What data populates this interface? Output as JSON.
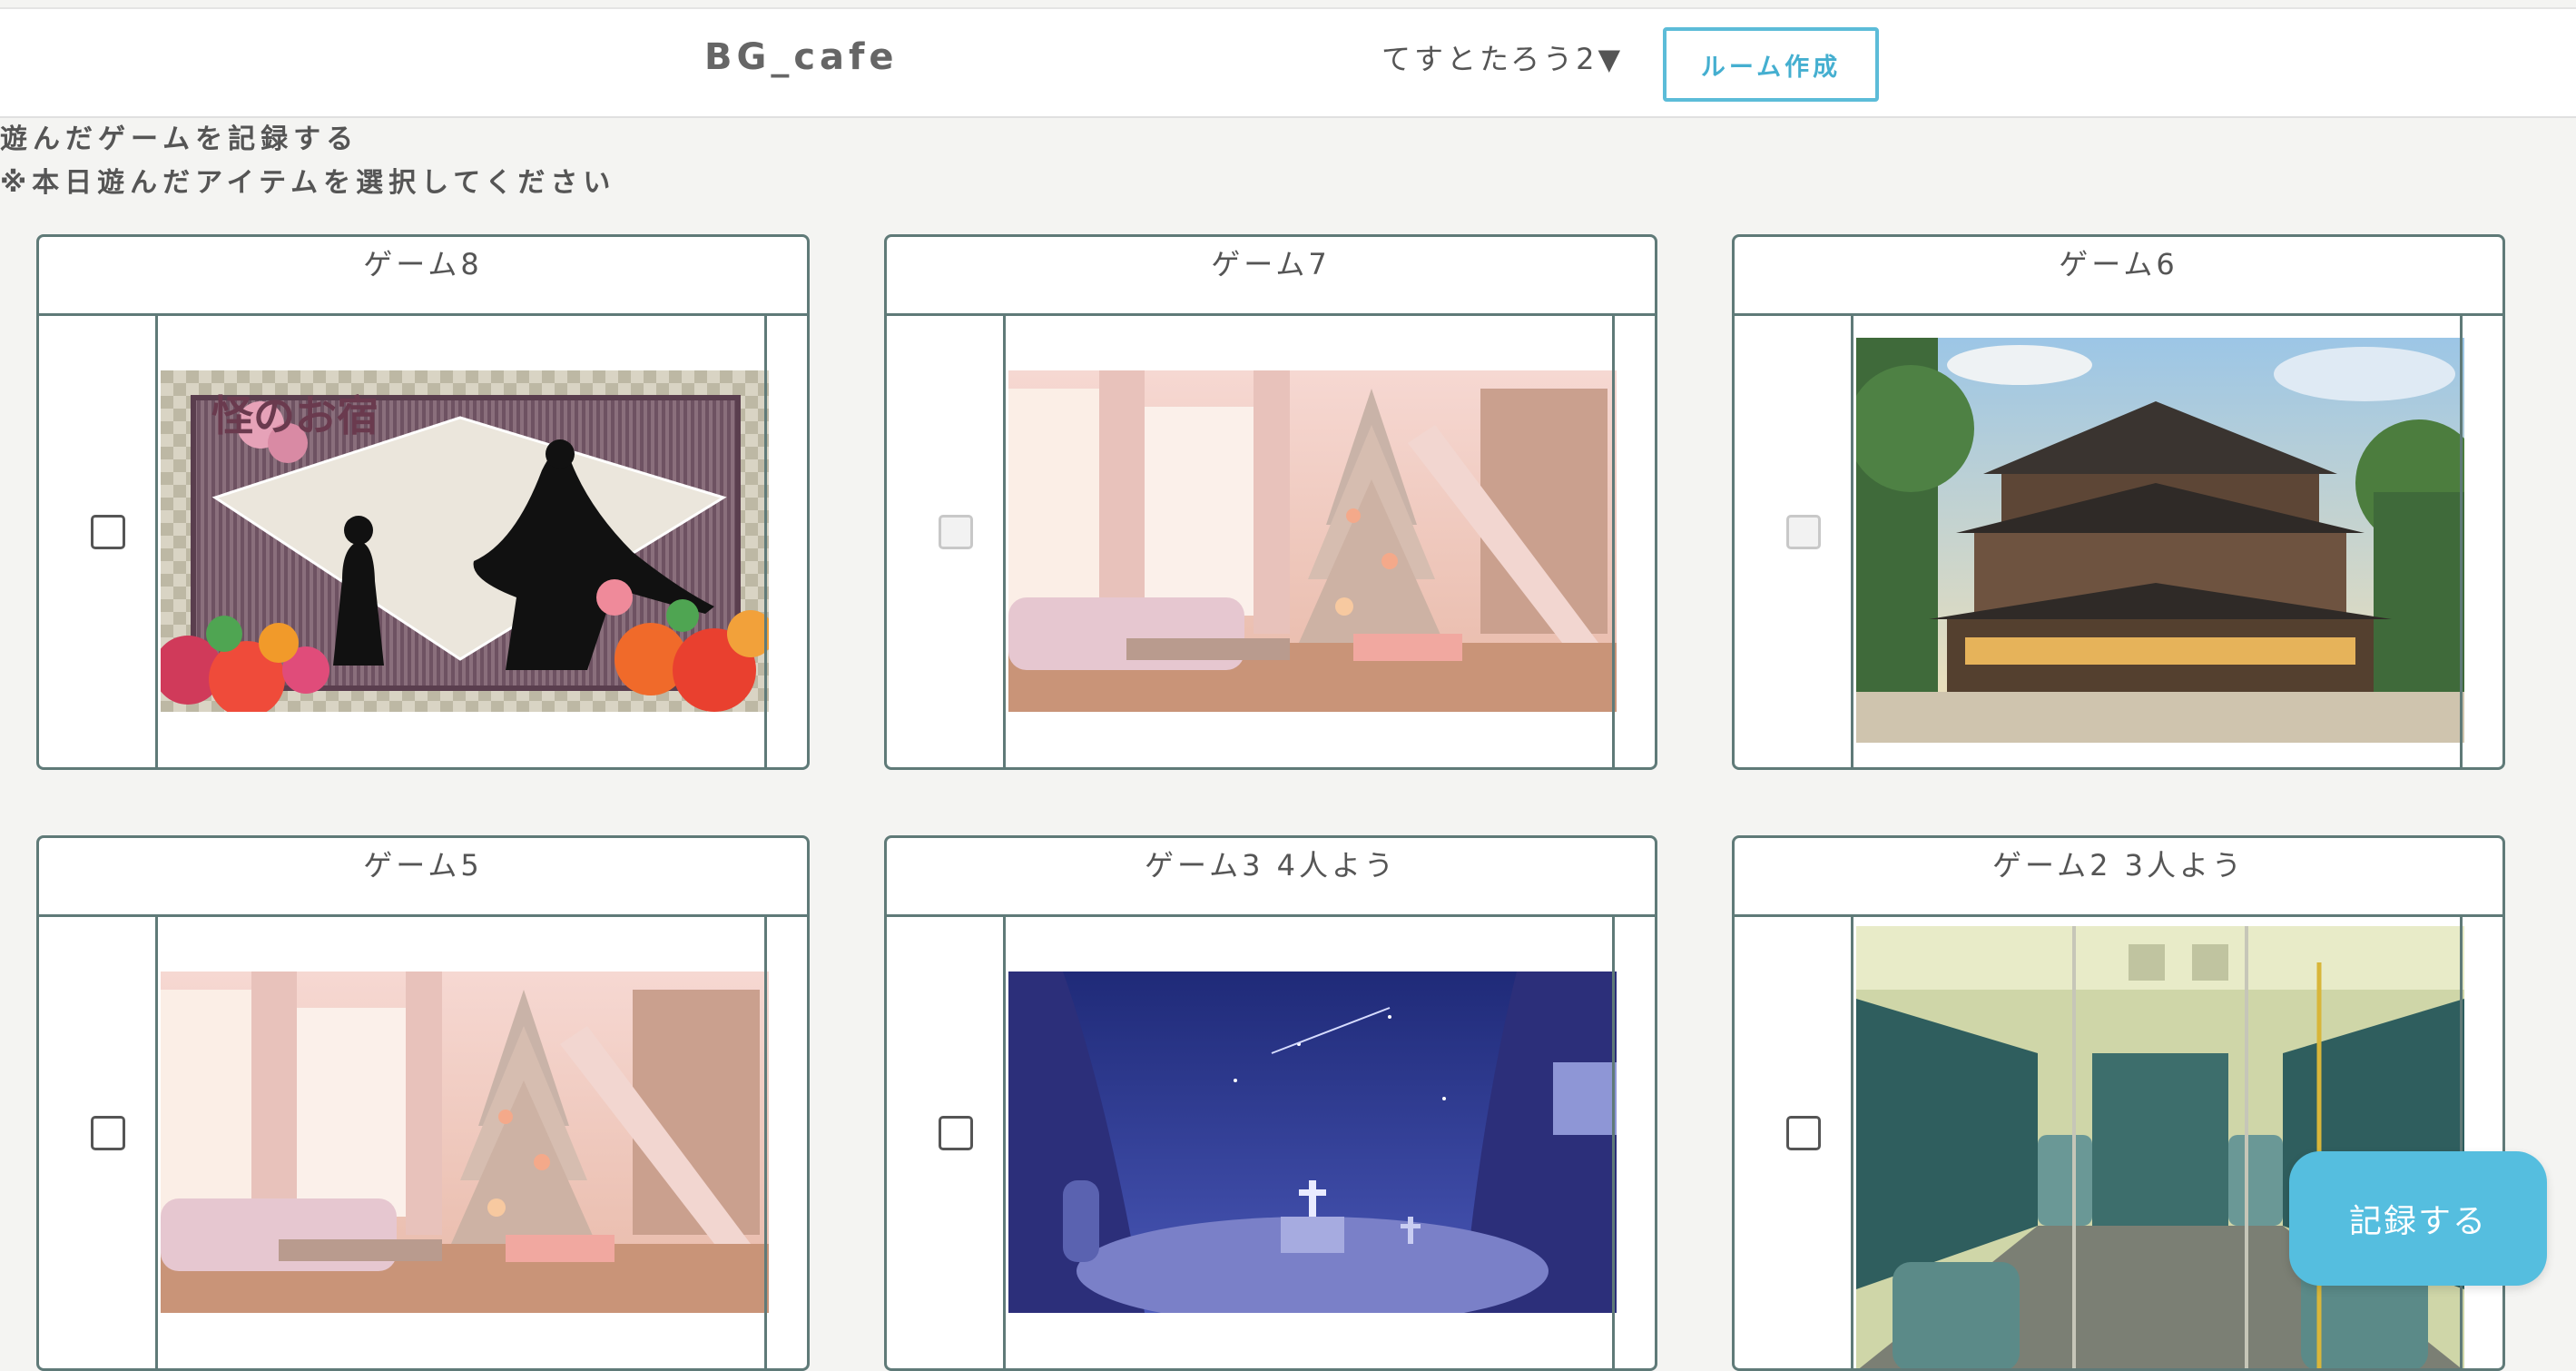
{
  "header": {
    "site_title": "BG_cafe",
    "user_menu_label": "てすとたろう2▼",
    "create_room_label": "ルーム作成"
  },
  "intro": {
    "heading": "遊んだゲームを記録する",
    "note": "※本日遊んだアイテムを選択してください"
  },
  "games": [
    {
      "title": "ゲーム8",
      "checked": false,
      "enabled": true,
      "thumbnail": "ryokan-silhouette-poster",
      "thumb_logo_text": "怪のお宿"
    },
    {
      "title": "ゲーム7",
      "checked": false,
      "enabled": false,
      "thumbnail": "christmas-living-room"
    },
    {
      "title": "ゲーム6",
      "checked": false,
      "enabled": false,
      "thumbnail": "japanese-inn-building"
    },
    {
      "title": "ゲーム5",
      "checked": false,
      "enabled": true,
      "thumbnail": "christmas-living-room"
    },
    {
      "title": "ゲーム3 4人よう",
      "checked": false,
      "enabled": true,
      "thumbnail": "night-forest-graveyard"
    },
    {
      "title": "ゲーム2 3人よう",
      "checked": false,
      "enabled": true,
      "thumbnail": "train-interior"
    }
  ],
  "record_button_label": "記録する",
  "colors": {
    "accent": "#55bedf",
    "card_border": "#5f7a78",
    "page_background": "#f4f4f2"
  }
}
